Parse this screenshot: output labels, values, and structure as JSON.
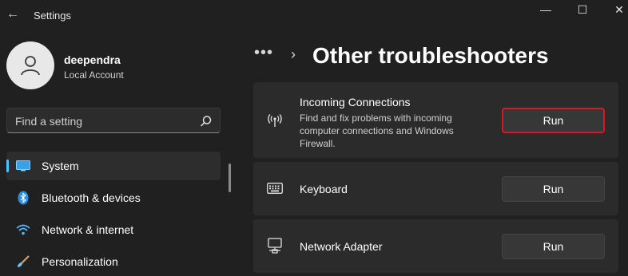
{
  "window": {
    "title": "Settings",
    "back_glyph": "←",
    "minimize_glyph": "—",
    "maximize_glyph": "☐",
    "close_glyph": "✕"
  },
  "profile": {
    "name": "deependra",
    "account_type": "Local Account",
    "avatar_icon": "user-icon"
  },
  "search": {
    "placeholder": "Find a setting",
    "icon": "search-icon"
  },
  "sidebar": {
    "items": [
      {
        "label": "System",
        "icon": "monitor-icon",
        "active": true
      },
      {
        "label": "Bluetooth & devices",
        "icon": "bluetooth-icon",
        "active": false
      },
      {
        "label": "Network & internet",
        "icon": "wifi-icon",
        "active": false
      },
      {
        "label": "Personalization",
        "icon": "brush-icon",
        "active": false
      }
    ]
  },
  "breadcrumb": {
    "more": "•••",
    "separator": "›",
    "title": "Other troubleshooters"
  },
  "troubleshooters": [
    {
      "title": "Incoming Connections",
      "description": "Find and fix problems with incoming computer connections and Windows Firewall.",
      "button": "Run",
      "icon": "broadcast-icon",
      "highlighted": true
    },
    {
      "title": "Keyboard",
      "button": "Run",
      "icon": "keyboard-icon",
      "highlighted": false
    },
    {
      "title": "Network Adapter",
      "button": "Run",
      "icon": "network-adapter-icon",
      "highlighted": false
    }
  ],
  "colors": {
    "background": "#202020",
    "card": "#2b2b2b",
    "accent": "#4cc2ff",
    "highlight_border": "#d9191f"
  }
}
